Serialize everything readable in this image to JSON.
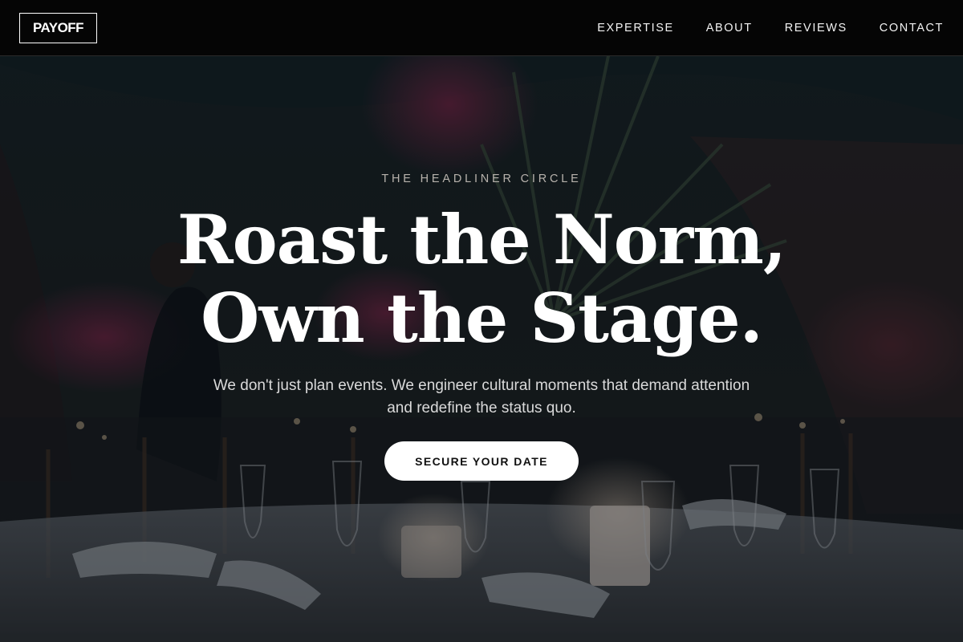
{
  "nav": {
    "logo": "PAYOFF",
    "links": [
      "EXPERTISE",
      "ABOUT",
      "REVIEWS",
      "CONTACT"
    ]
  },
  "hero": {
    "eyebrow": "THE HEADLINER CIRCLE",
    "headline_line1": "Roast the Norm,",
    "headline_line2": "Own the Stage.",
    "subtitle": "We don't just plan events. We engineer cultural moments that demand attention and redefine the status quo.",
    "cta": "SECURE YOUR DATE"
  },
  "colors": {
    "nav_background": "#050505",
    "text_primary": "#ffffff",
    "eyebrow": "#b7b2ac",
    "cta_background": "#ffffff",
    "cta_text": "#111111"
  },
  "background_image": "dim banquet table with centerpiece flowers, candles and glassware"
}
